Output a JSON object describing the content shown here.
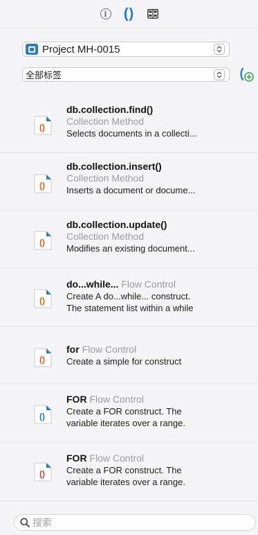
{
  "toolbar": {
    "info_glyph": "i",
    "braces_glyph": "()"
  },
  "project": {
    "label": "Project MH-0015"
  },
  "tags": {
    "label": "全部标签"
  },
  "snippets": [
    {
      "title": "db.collection.find()",
      "category": "Collection Method",
      "desc": "Selects documents in a collecti...",
      "icon_color": "#e8590c"
    },
    {
      "title": "db.collection.insert()",
      "category": "Collection Method",
      "desc": "Inserts a document or docume...",
      "icon_color": "#e8590c"
    },
    {
      "title": "db.collection.update()",
      "category": "Collection Method",
      "desc": "Modifies an existing document...",
      "icon_color": "#e8590c"
    },
    {
      "title": "do...while...",
      "category": "Flow Control",
      "desc": "Create A do...while... construct.",
      "desc2": "The statement list within a while",
      "icon_color": "#e8590c"
    },
    {
      "title": "for",
      "category": "Flow Control",
      "desc": "Create a simple for construct",
      "icon_color": "#e8590c"
    },
    {
      "title": "FOR",
      "category": "Flow Control",
      "desc": "Create a FOR construct. The",
      "desc2": "variable iterates over a range.",
      "icon_color": "#1a73e8"
    },
    {
      "title": "FOR",
      "category": "Flow Control",
      "desc": "Create a FOR construct. The",
      "desc2": "variable iterates over a range.",
      "icon_color": "#d32f2f"
    }
  ],
  "search": {
    "placeholder": "搜索"
  }
}
